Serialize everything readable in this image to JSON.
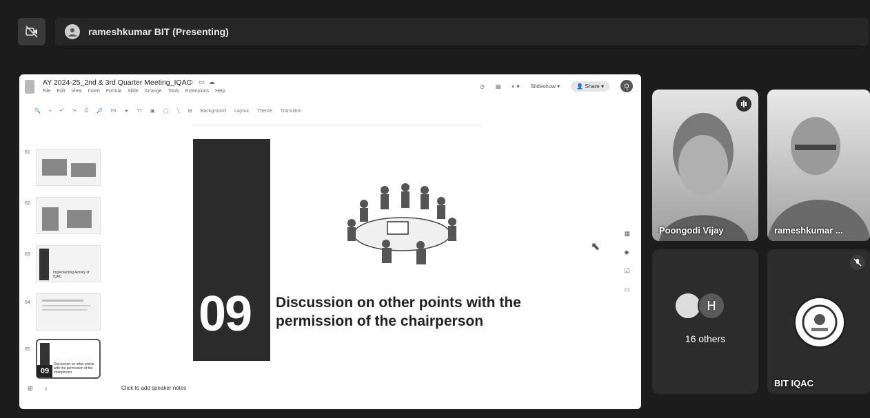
{
  "meet": {
    "presenter_label": "rameshkumar BIT (Presenting)"
  },
  "slides_app": {
    "doc_title": "AY 2024-25_2nd & 3rd Quarter Meeting_IQAC",
    "menus": [
      "File",
      "Edit",
      "View",
      "Insert",
      "Format",
      "Slide",
      "Arrange",
      "Tools",
      "Extensions",
      "Help"
    ],
    "slideshow_label": "Slideshow",
    "share_label": "Share",
    "account_initial": "Q",
    "toolbar": {
      "zoom": "Fit",
      "background": "Background",
      "layout": "Layout",
      "theme": "Theme",
      "transition": "Transition"
    },
    "filmstrip": {
      "numbers": [
        "61",
        "62",
        "63",
        "64",
        "65"
      ],
      "thumb3_text": "Implementing Activity of IQAC",
      "thumb5_number": "09",
      "thumb5_text": "Discussion on other points with the permission of the chairperson"
    },
    "speaker_notes_placeholder": "Click to add speaker notes",
    "current_slide": {
      "number": "09",
      "title": "Discussion on other points with the permission of the chairperson"
    }
  },
  "participants": [
    {
      "name": "Poongodi Vijay",
      "speaking": true
    },
    {
      "name": "rameshkumar ..."
    },
    {
      "others_count_label": "16 others",
      "avatar_letter": "H"
    },
    {
      "name": "BIT IQAC",
      "muted": true
    }
  ]
}
